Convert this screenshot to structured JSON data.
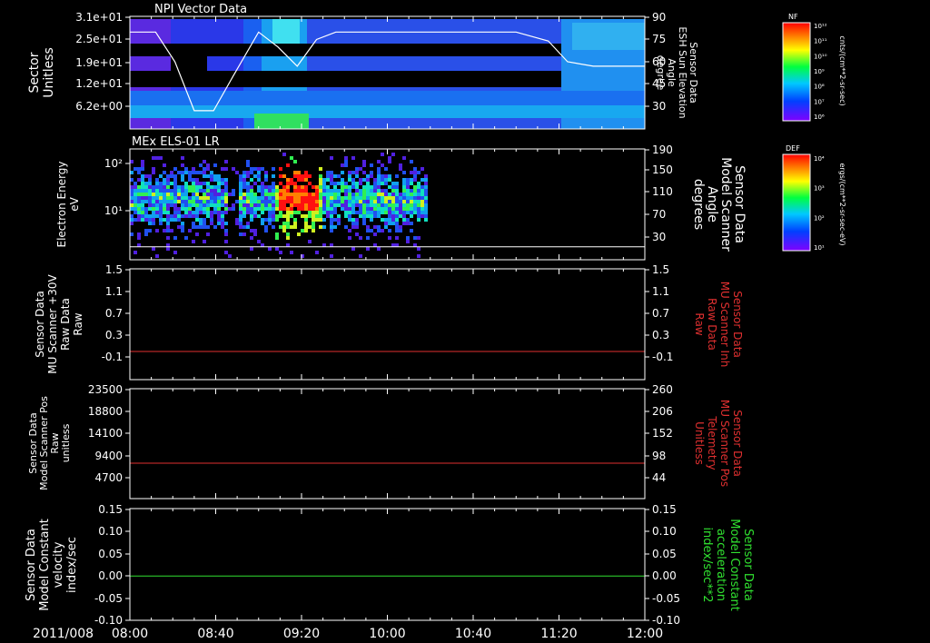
{
  "date_label": "2011/008",
  "time_ticks": [
    "08:00",
    "08:40",
    "09:20",
    "10:00",
    "10:40",
    "11:20",
    "12:00"
  ],
  "panels": [
    {
      "id": "npi",
      "title": "NPI Vector Data",
      "left_label": [
        "Sector",
        "Unitless"
      ],
      "left_ticks": [
        "3.1e+01",
        "2.5e+01",
        "1.9e+01",
        "1.2e+01",
        "6.2e+00"
      ],
      "right_label": [
        "Sensor Data",
        "ESH Sun Elevation",
        "Angle",
        "degree"
      ],
      "right_ticks": [
        "90",
        "75",
        "60",
        "45",
        "30"
      ],
      "colorbar": {
        "title": "NF",
        "unit": "cnts/(cm**2-sr-sec)",
        "labels": [
          "10¹²",
          "10¹¹",
          "10¹⁰",
          "10⁹",
          "10⁸",
          "10⁷",
          "10⁶"
        ]
      }
    },
    {
      "id": "els",
      "title": "MEx ELS-01 LR",
      "left_label": [
        "Electron Energy",
        "eV"
      ],
      "left_ticks": [
        "10²",
        "10¹"
      ],
      "right_label": [
        "Sensor Data",
        "Model Scanner",
        "Angle",
        "degrees"
      ],
      "right_ticks": [
        "190",
        "150",
        "110",
        "70",
        "30"
      ],
      "colorbar": {
        "title": "DEF",
        "unit": "ergs/(cm**2-sr-sec-eV)",
        "labels": [
          "10⁴",
          "10³",
          "10²",
          "10¹"
        ]
      }
    },
    {
      "id": "mu_raw",
      "left_label": [
        "Sensor Data",
        "MU Scanner +30V",
        "Raw Data",
        "Raw"
      ],
      "left_ticks": [
        "1.5",
        "1.1",
        "0.7",
        "0.3",
        "-0.1"
      ],
      "right_label": [
        "Sensor Data",
        "MU Scanner Inh",
        "Raw Data",
        "Raw"
      ],
      "right_ticks": [
        "1.5",
        "1.1",
        "0.7",
        "0.3",
        "-0.1"
      ],
      "line_color": "#e03030"
    },
    {
      "id": "scanner_pos",
      "left_label": [
        "Sensor Data",
        "Model Scanner Pos",
        "Raw",
        "unitless"
      ],
      "left_ticks": [
        "23500",
        "18800",
        "14100",
        "9400",
        "4700"
      ],
      "right_label": [
        "Sensor Data",
        "MU Scanner Pos",
        "Telemetry",
        "Unitless"
      ],
      "right_ticks": [
        "260",
        "206",
        "152",
        "98",
        "44"
      ],
      "line_color": "#e03030"
    },
    {
      "id": "constant",
      "left_label": [
        "Sensor Data",
        "Model Constant",
        "velocity",
        "index/sec"
      ],
      "left_ticks": [
        "0.15",
        "0.10",
        "0.05",
        "0.00",
        "-0.05",
        "-0.10"
      ],
      "right_label": [
        "Sensor Data",
        "Model Constant",
        "acceleration",
        "index/sec**2"
      ],
      "right_ticks": [
        "0.15",
        "0.10",
        "0.05",
        "0.00",
        "-0.05",
        "-0.10"
      ],
      "line_color": "#30e030"
    }
  ],
  "chart_data": [
    {
      "type": "heatmap",
      "title": "NPI Vector Data",
      "ylabel": "Sector Unitless",
      "y2label": "Sensor Data ESH Sun Elevation Angle degree",
      "x": [
        "08:00",
        "08:40",
        "09:20",
        "10:00",
        "10:40",
        "11:20",
        "12:00"
      ],
      "ylim": [
        0,
        31
      ],
      "y2lim": [
        15,
        90
      ],
      "series": [
        {
          "name": "Sensor Data ESH Sun Elevation Angle",
          "x_hours": [
            8.0,
            8.2,
            8.35,
            8.5,
            8.65,
            8.8,
            9.0,
            9.15,
            9.3,
            9.45,
            9.6,
            9.8,
            10.5,
            11.0,
            11.25,
            11.4,
            11.6,
            12.0
          ],
          "values": [
            80,
            80,
            60,
            27,
            27,
            50,
            80,
            70,
            57,
            75,
            80,
            80,
            80,
            80,
            74,
            60,
            57,
            57
          ]
        }
      ]
    },
    {
      "type": "heatmap",
      "title": "MEx ELS-01 LR",
      "ylabel": "Electron Energy eV",
      "y2label": "Sensor Data Model Scanner Angle degrees",
      "x": [
        "08:00",
        "08:40",
        "09:20",
        "10:00",
        "10:40",
        "11:20",
        "12:00"
      ],
      "y2lim": [
        10,
        190
      ],
      "series": [
        {
          "name": "Sensor Data Model Scanner Angle",
          "x_hours": [
            8.0,
            12.0
          ],
          "values": [
            12,
            12
          ]
        }
      ]
    },
    {
      "type": "line",
      "ylabel": "Sensor Data MU Scanner +30V Raw Data Raw",
      "y2label": "Sensor Data MU Scanner Inh Raw Data Raw",
      "x": [
        "08:00",
        "08:40",
        "09:20",
        "10:00",
        "10:40",
        "11:20",
        "12:00"
      ],
      "ylim": [
        -0.3,
        1.5
      ],
      "series": [
        {
          "name": "Sensor Data MU Scanner Inh Raw Data Raw",
          "x_hours": [
            8.0,
            12.0
          ],
          "values": [
            0.0,
            0.0
          ]
        }
      ]
    },
    {
      "type": "line",
      "ylabel": "Sensor Data Model Scanner Pos Raw unitless",
      "y2label": "Sensor Data MU Scanner Pos Telemetry Unitless",
      "x": [
        "08:00",
        "08:40",
        "09:20",
        "10:00",
        "10:40",
        "11:20",
        "12:00"
      ],
      "ylim": [
        0,
        23500
      ],
      "series": [
        {
          "name": "Sensor Data MU Scanner Pos Telemetry Unitless",
          "x_hours": [
            8.0,
            12.0
          ],
          "values": [
            7800,
            7800
          ]
        }
      ]
    },
    {
      "type": "line",
      "ylabel": "Sensor Data Model Constant velocity index/sec",
      "y2label": "Sensor Data Model Constant acceleration index/sec**2",
      "x": [
        "08:00",
        "08:40",
        "09:20",
        "10:00",
        "10:40",
        "11:20",
        "12:00"
      ],
      "ylim": [
        -0.1,
        0.15
      ],
      "series": [
        {
          "name": "Sensor Data Model Constant acceleration index/sec**2",
          "x_hours": [
            8.0,
            12.0
          ],
          "values": [
            0.0,
            0.0
          ]
        }
      ]
    }
  ]
}
